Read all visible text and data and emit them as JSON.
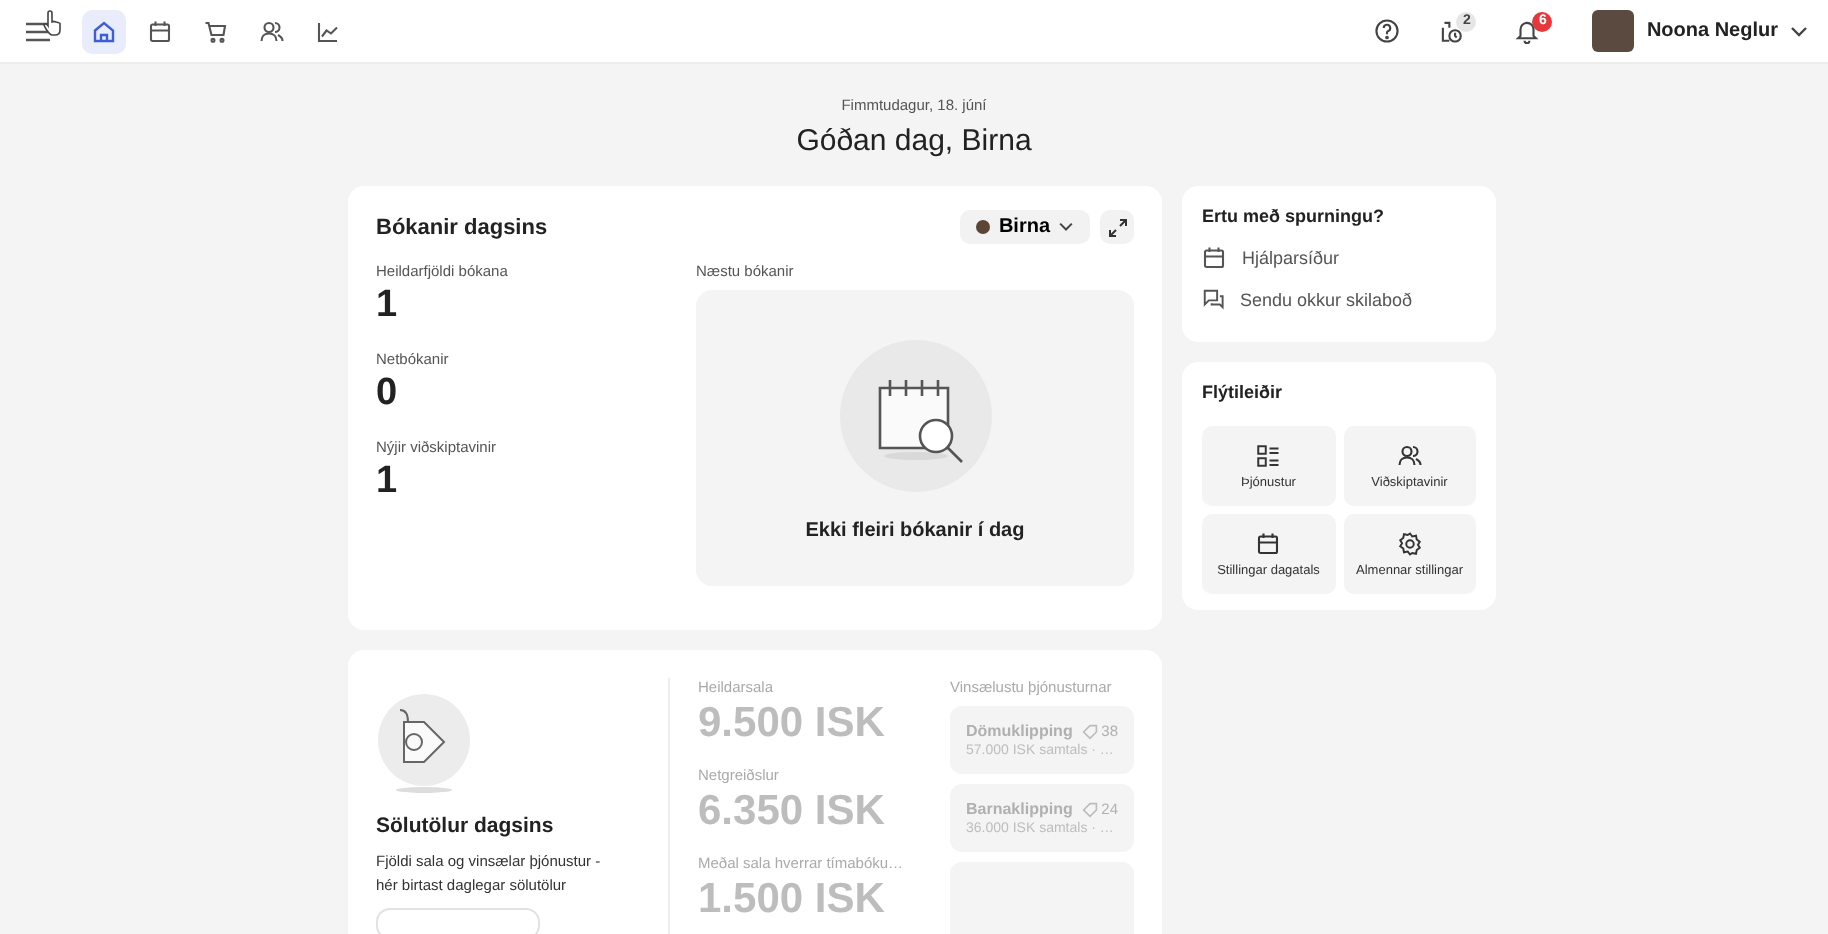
{
  "topbar": {
    "nav_items": [
      {
        "kind": "home",
        "selected": true
      },
      {
        "kind": "calendar",
        "selected": false
      },
      {
        "kind": "cart",
        "selected": false
      },
      {
        "kind": "people",
        "selected": false
      },
      {
        "kind": "chart",
        "selected": false
      }
    ],
    "actions": [
      {
        "kind": "help"
      },
      {
        "kind": "timer",
        "badge": "2",
        "color": "#e6e6e6"
      },
      {
        "kind": "bell",
        "badge": "6",
        "color": "#e5383b"
      }
    ],
    "user": {
      "name": "Noona Neglur"
    }
  },
  "date": "Fimmtudagur, 18. júní",
  "greeting": "Góðan dag, Birna",
  "bookings": {
    "title": "Bókanir dagsins",
    "staff_filter": "Birna",
    "stats": [
      {
        "label": "Heildarfjöldi bókana",
        "value": "1"
      },
      {
        "label": "Netbókanir",
        "value": "0"
      },
      {
        "label": "Nýjir viðskiptavinir",
        "value": "1"
      }
    ],
    "upcoming_label": "Næstu bókanir",
    "empty_text": "Ekki fleiri bókanir í dag"
  },
  "help": {
    "title": "Ertu með spurningu?",
    "links": [
      {
        "kind": "calendar",
        "label": "Hjálparsíður"
      },
      {
        "kind": "chat",
        "label": "Sendu okkur skilaboð"
      }
    ]
  },
  "shortcuts": {
    "title": "Flýtileiðir",
    "items": [
      {
        "kind": "list",
        "label": "Þjónustur"
      },
      {
        "kind": "people",
        "label": "Viðskiptavinir"
      },
      {
        "kind": "calendar",
        "label": "Stillingar dagatals"
      },
      {
        "kind": "gear",
        "label": "Almennar stillingar"
      }
    ]
  },
  "sales": {
    "title": "Sölutölur dagsins",
    "description": "Fjöldi sala og vinsælar þjónustur - hér birtast daglegar sölutölur",
    "stats": [
      {
        "label": "Heildarsala",
        "value": "9.500 ISK"
      },
      {
        "label": "Netgreiðslur",
        "value": "6.350 ISK"
      },
      {
        "label": "Meðal sala hverrar tímabóku…",
        "value": "1.500 ISK"
      }
    ],
    "popular_title": "Vinsælustu þjónusturnar",
    "services": [
      {
        "name": "Dömuklipping",
        "count": "38",
        "summary": "57.000 ISK samtals · …"
      },
      {
        "name": "Barnaklipping",
        "count": "24",
        "summary": "36.000 ISK samtals · …"
      }
    ]
  }
}
